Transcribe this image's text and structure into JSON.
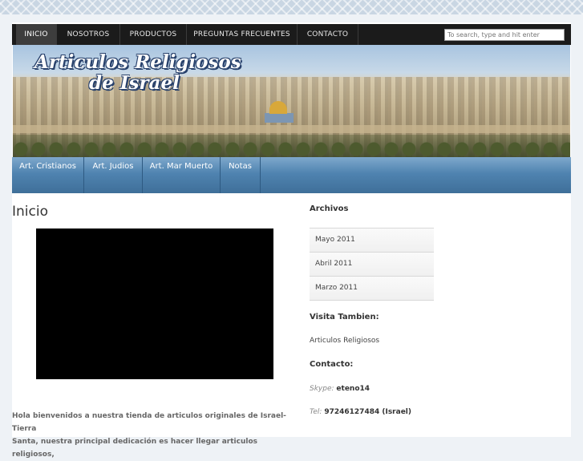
{
  "top_nav": {
    "items": [
      {
        "label": "INICIO"
      },
      {
        "label": "NOSOTROS"
      },
      {
        "label": "PRODUCTOS"
      },
      {
        "label": "PREGUNTAS FRECUENTES"
      },
      {
        "label": "CONTACTO"
      }
    ],
    "search_placeholder": "To search, type and hit enter"
  },
  "banner": {
    "line1": "Articulos Religiosos",
    "line2": "de Israel"
  },
  "sub_nav": {
    "items": [
      {
        "label": "Art. Cristianos"
      },
      {
        "label": "Art. Judios"
      },
      {
        "label": "Art. Mar Muerto"
      },
      {
        "label": "Notas"
      }
    ]
  },
  "main": {
    "title": "Inicio",
    "body_line1": "Hola  bienvenidos a nuestra tienda de articulos originales de Israel-Tierra",
    "body_line2": "Santa, nuestra principal dedicación es hacer llegar articulos religiosos,"
  },
  "sidebar": {
    "archives_heading": "Archivos",
    "archives": [
      {
        "label": "Mayo 2011"
      },
      {
        "label": "Abril 2011"
      },
      {
        "label": "Marzo 2011"
      }
    ],
    "visit_heading": "Visita Tambien:",
    "visit_link": "Articulos Religiosos",
    "contact_heading": "Contacto:",
    "skype_label": "Skype:",
    "skype_value": "eteno14",
    "tel_label": "Tel:",
    "tel_value": "97246127484 (Israel)"
  },
  "colors": {
    "top_nav_bg": "#1b1b1b",
    "sub_nav_bg": "#4f83b0",
    "page_bg": "#eef2f6"
  }
}
